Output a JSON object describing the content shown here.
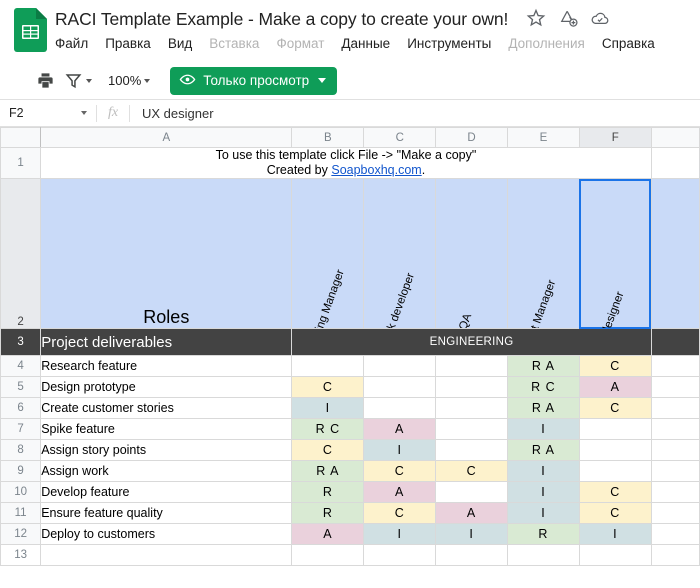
{
  "app": {
    "logo_icon": "sheets-logo-icon",
    "doc_title": "RACI Template Example - Make a copy to create your own!",
    "title_icons": [
      {
        "name": "star-icon",
        "glyph": "star"
      },
      {
        "name": "drive-add-icon",
        "glyph": "drive-add"
      },
      {
        "name": "cloud-saved-icon",
        "glyph": "cloud-check"
      }
    ],
    "menu": [
      {
        "label": "Файл",
        "disabled": false
      },
      {
        "label": "Правка",
        "disabled": false
      },
      {
        "label": "Вид",
        "disabled": false
      },
      {
        "label": "Вставка",
        "disabled": true
      },
      {
        "label": "Формат",
        "disabled": true
      },
      {
        "label": "Данные",
        "disabled": false
      },
      {
        "label": "Инструменты",
        "disabled": false
      },
      {
        "label": "Дополнения",
        "disabled": true
      },
      {
        "label": "Справка",
        "disabled": false
      }
    ]
  },
  "toolbar": {
    "print_icon": "print-icon",
    "filter_icon": "filter-icon",
    "zoom_value": "100%",
    "viewonly_icon": "eye-icon",
    "viewonly_label": "Только просмотр"
  },
  "formula_bar": {
    "name_box_value": "F2",
    "fx_label": "fx",
    "formula_value": "UX designer"
  },
  "grid": {
    "columns": [
      "A",
      "B",
      "C",
      "D",
      "E",
      "F"
    ],
    "selected_column": "F",
    "selected_cell": "F2",
    "row_numbers": [
      "1",
      "2",
      "3",
      "4",
      "5",
      "6",
      "7",
      "8",
      "9",
      "10",
      "11",
      "12",
      "13"
    ],
    "selected_row": "2",
    "note": {
      "line1": "To use this template click File -> \"Make a copy\"",
      "line2_prefix": "Created by ",
      "line2_link": "Soapboxhq.com",
      "line2_suffix": "."
    },
    "roles": {
      "label": "Roles",
      "names": [
        "Engineering Manager",
        "Full-stack developer",
        "QA",
        "Product Manager",
        "UX designer"
      ]
    },
    "section": {
      "title": "Project deliverables",
      "subtitle": "ENGINEERING"
    },
    "rows": [
      {
        "label": "Research feature",
        "cells": [
          {
            "v": "",
            "f": "none"
          },
          {
            "v": "",
            "f": "none"
          },
          {
            "v": "",
            "f": "none"
          },
          {
            "v": "R A",
            "f": "green"
          },
          {
            "v": "C",
            "f": "yellow"
          }
        ]
      },
      {
        "label": "Design prototype",
        "cells": [
          {
            "v": "C",
            "f": "yellow"
          },
          {
            "v": "",
            "f": "none"
          },
          {
            "v": "",
            "f": "none"
          },
          {
            "v": "R C",
            "f": "green"
          },
          {
            "v": "A",
            "f": "pink"
          }
        ]
      },
      {
        "label": "Create customer stories",
        "cells": [
          {
            "v": "I",
            "f": "blue"
          },
          {
            "v": "",
            "f": "none"
          },
          {
            "v": "",
            "f": "none"
          },
          {
            "v": "R A",
            "f": "green"
          },
          {
            "v": "C",
            "f": "yellow"
          }
        ]
      },
      {
        "label": "Spike feature",
        "cells": [
          {
            "v": "R C",
            "f": "green"
          },
          {
            "v": "A",
            "f": "pink"
          },
          {
            "v": "",
            "f": "none"
          },
          {
            "v": "I",
            "f": "blue"
          },
          {
            "v": "",
            "f": "none"
          }
        ]
      },
      {
        "label": "Assign story points",
        "cells": [
          {
            "v": "C",
            "f": "yellow"
          },
          {
            "v": "I",
            "f": "blue"
          },
          {
            "v": "",
            "f": "none"
          },
          {
            "v": "R A",
            "f": "green"
          },
          {
            "v": "",
            "f": "none"
          }
        ]
      },
      {
        "label": "Assign work",
        "cells": [
          {
            "v": "R A",
            "f": "green"
          },
          {
            "v": "C",
            "f": "yellow"
          },
          {
            "v": "C",
            "f": "yellow"
          },
          {
            "v": "I",
            "f": "blue"
          },
          {
            "v": "",
            "f": "none"
          }
        ]
      },
      {
        "label": "Develop feature",
        "cells": [
          {
            "v": "R",
            "f": "green"
          },
          {
            "v": "A",
            "f": "pink"
          },
          {
            "v": "",
            "f": "none"
          },
          {
            "v": "I",
            "f": "blue"
          },
          {
            "v": "C",
            "f": "yellow"
          }
        ]
      },
      {
        "label": "Ensure feature quality",
        "cells": [
          {
            "v": "R",
            "f": "green"
          },
          {
            "v": "C",
            "f": "yellow"
          },
          {
            "v": "A",
            "f": "pink"
          },
          {
            "v": "I",
            "f": "blue"
          },
          {
            "v": "C",
            "f": "yellow"
          }
        ]
      },
      {
        "label": "Deploy to customers",
        "cells": [
          {
            "v": "A",
            "f": "pink"
          },
          {
            "v": "I",
            "f": "blue"
          },
          {
            "v": "I",
            "f": "blue"
          },
          {
            "v": "R",
            "f": "green"
          },
          {
            "v": "I",
            "f": "blue"
          }
        ]
      },
      {
        "label": "",
        "cells": [
          {
            "v": "",
            "f": "none"
          },
          {
            "v": "",
            "f": "none"
          },
          {
            "v": "",
            "f": "none"
          },
          {
            "v": "",
            "f": "none"
          },
          {
            "v": "",
            "f": "none"
          }
        ]
      }
    ]
  },
  "colors": {
    "brand_green": "#0f9d58",
    "selection_blue": "#1a73e8",
    "header_blue": "#c9daf8",
    "section_dark": "#434343",
    "fill_green": "#d9ead3",
    "fill_yellow": "#fdf2cc",
    "fill_pink": "#ead1dc",
    "fill_blue": "#d0e0e3",
    "link_blue": "#1155cc"
  }
}
